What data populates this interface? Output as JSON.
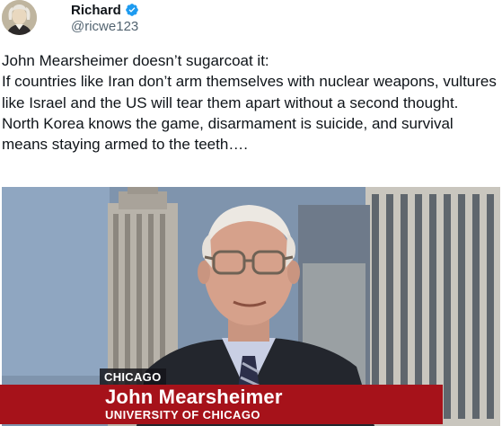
{
  "author": {
    "name": "Richard",
    "handle": "@ricwe123",
    "verified": true,
    "verified_color": "#1d9bf0",
    "avatar_icon": "portrait-avatar"
  },
  "tweet": {
    "lines": [
      "John Mearsheimer doesn’t sugarcoat it:",
      "If countries like Iran don’t arm themselves with nuclear weapons, vultures like Israel and the US will tear them apart without a second thought.",
      "North Korea knows the game, disarmament is suicide, and survival means staying armed to the teeth…."
    ]
  },
  "media": {
    "location_tag": "CHICAGO",
    "lower_third_name": "John Mearsheimer",
    "lower_third_title": "UNIVERSITY OF CHICAGO",
    "lower_third_color": "#a6121a"
  }
}
